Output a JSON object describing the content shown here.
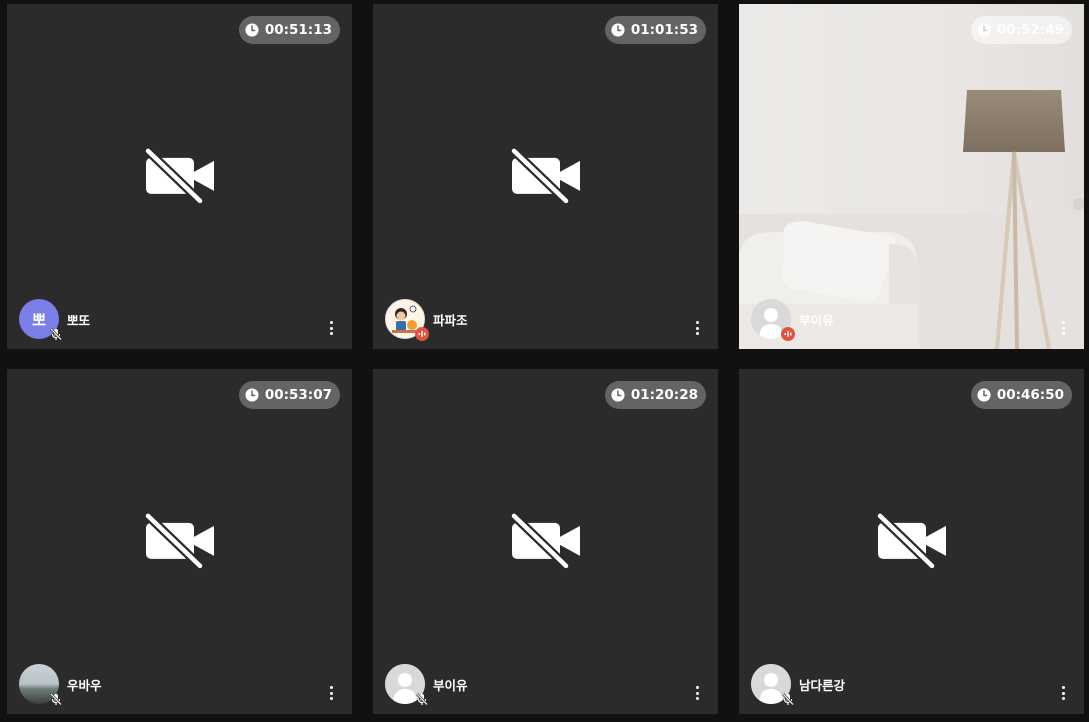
{
  "colors": {
    "background": "#111111",
    "tile": "#2b2b2b",
    "speaking_badge": "#e2533e",
    "avatar_text_bg": "#7b7ee6"
  },
  "participants": [
    {
      "name": "뽀또",
      "timer": "00:51:13",
      "avatar": "text",
      "avatar_text": "뽀",
      "camera": "off",
      "mic": "muted"
    },
    {
      "name": "파파조",
      "timer": "01:01:53",
      "avatar": "cartoon",
      "camera": "off",
      "mic": "speaking"
    },
    {
      "name": "부이유",
      "timer": "00:52:49",
      "avatar": "default",
      "camera": "on",
      "mic": "speaking"
    },
    {
      "name": "우바우",
      "timer": "00:53:07",
      "avatar": "photo",
      "camera": "off",
      "mic": "muted"
    },
    {
      "name": "부이유",
      "timer": "01:20:28",
      "avatar": "default",
      "camera": "off",
      "mic": "muted"
    },
    {
      "name": "남다른강",
      "timer": "00:46:50",
      "avatar": "default",
      "camera": "off",
      "mic": "muted"
    }
  ]
}
